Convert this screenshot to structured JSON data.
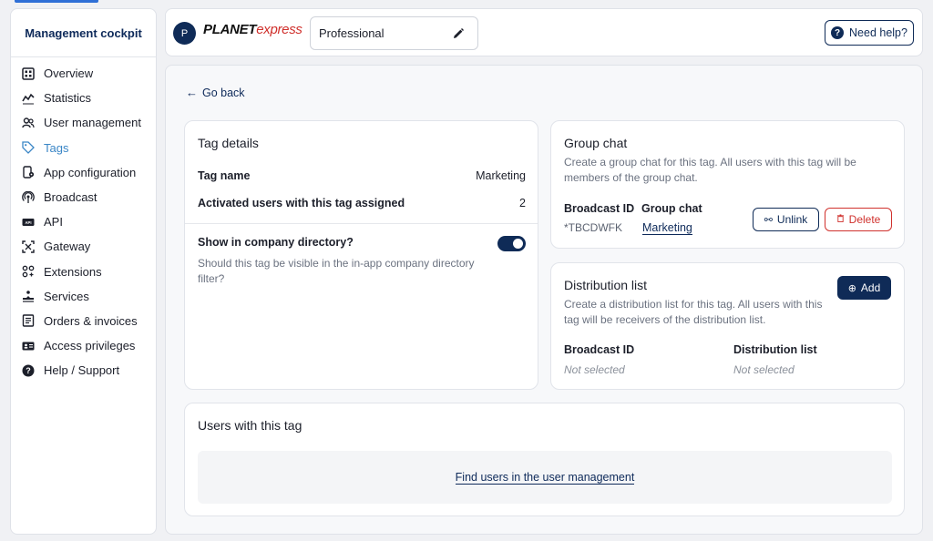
{
  "sidebar": {
    "title": "Management cockpit",
    "items": [
      {
        "label": "Overview",
        "icon": "grid-icon"
      },
      {
        "label": "Statistics",
        "icon": "chart-line-icon"
      },
      {
        "label": "User management",
        "icon": "users-icon"
      },
      {
        "label": "Tags",
        "icon": "tag-icon"
      },
      {
        "label": "App configuration",
        "icon": "phone-settings-icon"
      },
      {
        "label": "Broadcast",
        "icon": "broadcast-icon"
      },
      {
        "label": "API",
        "icon": "api-icon"
      },
      {
        "label": "Gateway",
        "icon": "gateway-icon"
      },
      {
        "label": "Extensions",
        "icon": "extensions-icon"
      },
      {
        "label": "Services",
        "icon": "services-icon"
      },
      {
        "label": "Orders & invoices",
        "icon": "invoice-icon"
      },
      {
        "label": "Access privileges",
        "icon": "id-card-icon"
      },
      {
        "label": "Help / Support",
        "icon": "help-icon"
      }
    ],
    "active_index": 3
  },
  "topbar": {
    "avatar_initial": "P",
    "logo_part1": "PLANET",
    "logo_part2": "express",
    "plan": "Professional",
    "help_label": "Need help?"
  },
  "main": {
    "back_label": "Go back",
    "tag_details": {
      "title": "Tag details",
      "name_label": "Tag name",
      "name_value": "Marketing",
      "activated_label": "Activated users with this tag assigned",
      "activated_value": "2",
      "directory_label": "Show in company directory?",
      "directory_desc": "Should this tag be visible in the in-app company directory filter?",
      "directory_enabled": true
    },
    "group_chat": {
      "title": "Group chat",
      "desc": "Create a group chat for this tag. All users with this tag will be members of the group chat.",
      "broadcast_id_label": "Broadcast ID",
      "broadcast_id_value": "*TBCDWFK",
      "group_chat_label": "Group chat",
      "group_chat_value": "Marketing",
      "unlink_label": "Unlink",
      "delete_label": "Delete"
    },
    "distribution_list": {
      "title": "Distribution list",
      "desc": "Create a distribution list for this tag. All users with this tag will be receivers of the distribution list.",
      "add_label": "Add",
      "broadcast_id_label": "Broadcast ID",
      "broadcast_id_value": "Not selected",
      "list_label": "Distribution list",
      "list_value": "Not selected"
    },
    "users": {
      "title": "Users with this tag",
      "link": "Find users in the user management"
    }
  },
  "colors": {
    "primary": "#0f2b57",
    "active_nav": "#3a86c6",
    "danger": "#d0312d"
  }
}
